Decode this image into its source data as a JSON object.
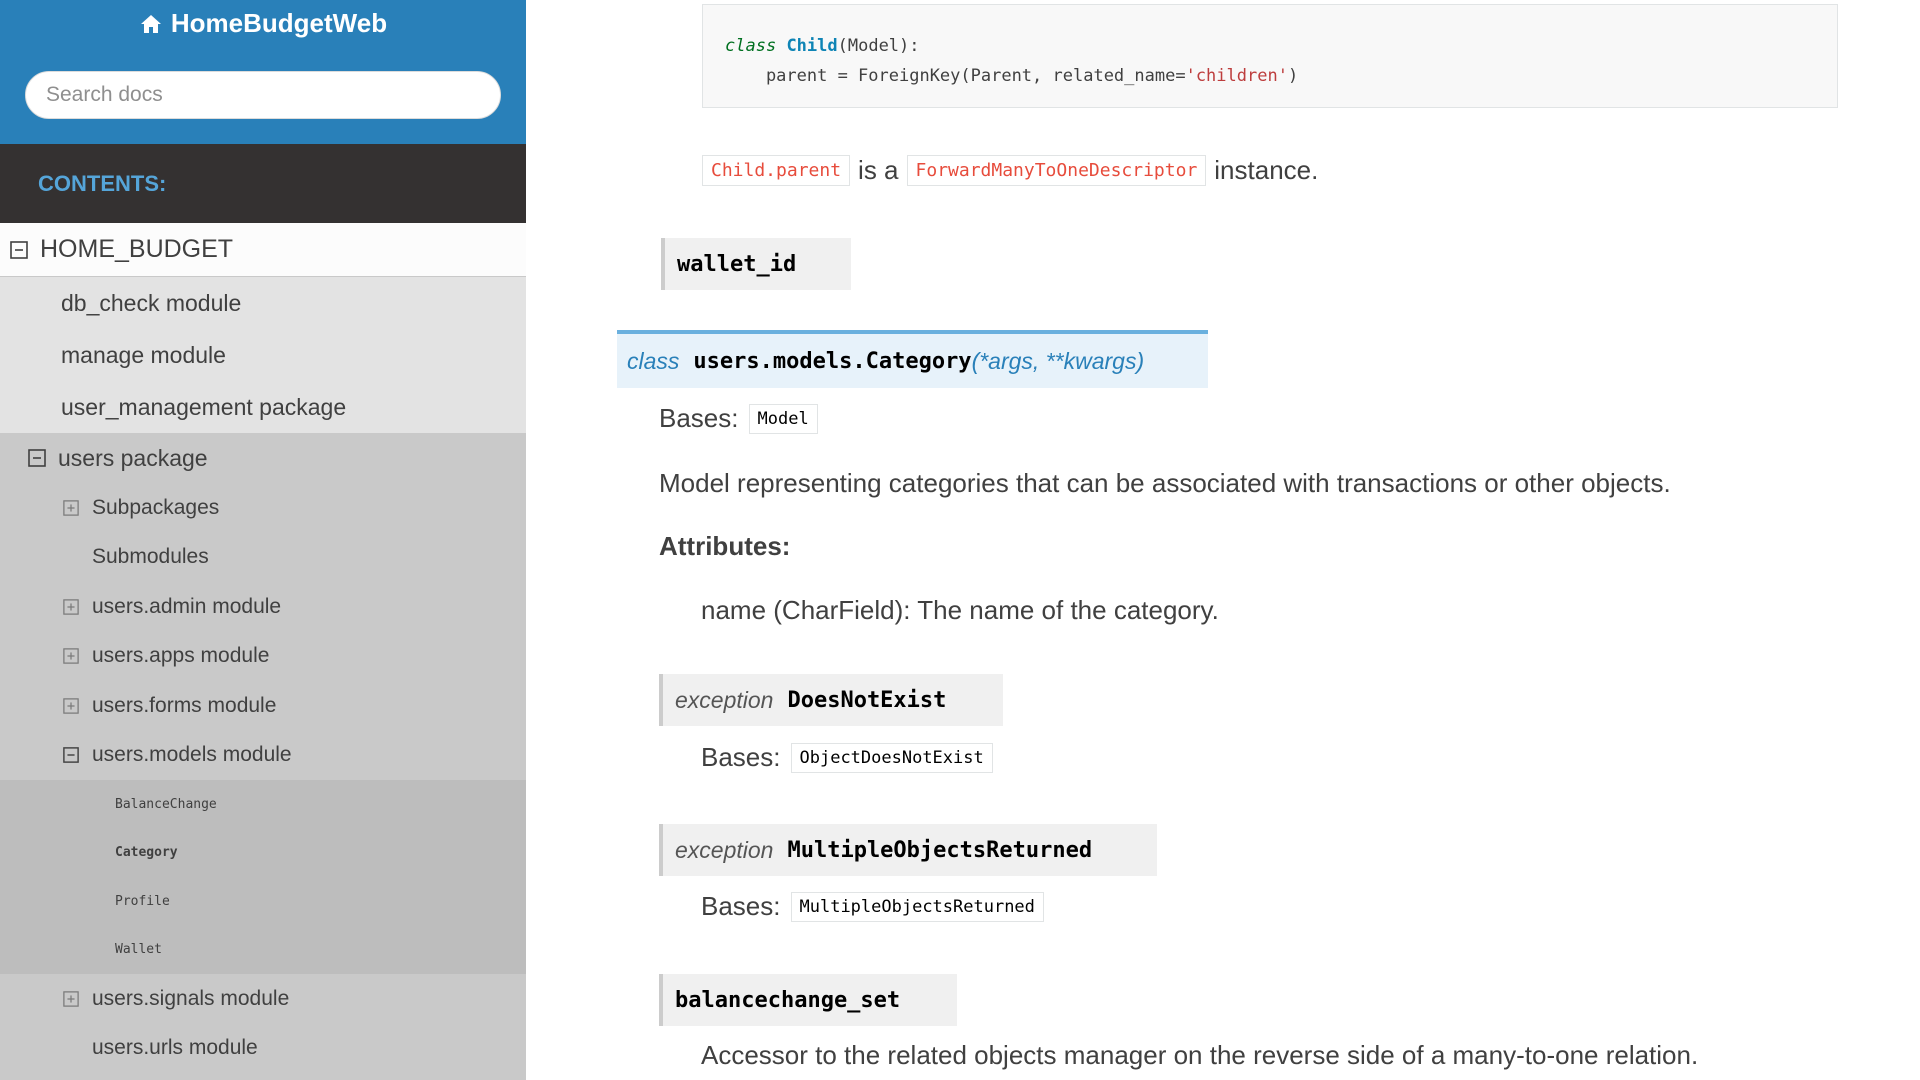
{
  "sidebar": {
    "brand": "HomeBudgetWeb",
    "search_placeholder": "Search docs",
    "contents_label": "CONTENTS:",
    "root": "HOME_BUDGET",
    "modules": [
      "db_check module",
      "manage module",
      "user_management package"
    ],
    "users_package": "users package",
    "users_children": [
      {
        "label": "Subpackages",
        "icon": "plus-square-icon"
      },
      {
        "label": "Submodules",
        "icon": ""
      },
      {
        "label": "users.admin module",
        "icon": "plus-square-icon"
      },
      {
        "label": "users.apps module",
        "icon": "plus-square-icon"
      },
      {
        "label": "users.forms module",
        "icon": "plus-square-icon"
      },
      {
        "label": "users.models module",
        "icon": "minus-square-icon"
      }
    ],
    "models_children": [
      "BalanceChange",
      "Category",
      "Profile",
      "Wallet"
    ],
    "after_models": [
      {
        "label": "users.signals module",
        "icon": "plus-square-icon"
      },
      {
        "label": "users.urls module",
        "icon": ""
      }
    ]
  },
  "main": {
    "code": {
      "kw_class": "class",
      "classname": "Child",
      "base": "(Model):",
      "line2_pre": "    parent = ForeignKey(Parent, related_name=",
      "line2_str": "'children'",
      "line2_post": ")"
    },
    "descriptor": {
      "lit1": "Child.parent",
      "mid": "is a",
      "lit2": "ForwardManyToOneDescriptor",
      "post": "instance."
    },
    "wallet_id": "wallet_id",
    "category_sig": {
      "em": "class",
      "name": "users.models.Category",
      "args": "(*args, **kwargs)"
    },
    "bases_label": "Bases:",
    "category_base": "Model",
    "category_desc": "Model representing categories that can be associated with transactions or other objects.",
    "attributes_label": "Attributes:",
    "attribute_text": "name (CharField): The name of the category.",
    "exc1": {
      "em": "exception",
      "name": "DoesNotExist",
      "base": "ObjectDoesNotExist"
    },
    "exc2": {
      "em": "exception",
      "name": "MultipleObjectsReturned",
      "base": "MultipleObjectsReturned"
    },
    "balancechange_set": "balancechange_set",
    "accessor_text": "Accessor to the related objects manager on the reverse side of a many-to-one relation."
  },
  "colors": {
    "sidebar_top": "#2980b9",
    "contents_bar": "#343131",
    "contents_text": "#55a5d9",
    "literal_text": "#e74c3c",
    "class_sig_bg": "#e7f2fa"
  }
}
